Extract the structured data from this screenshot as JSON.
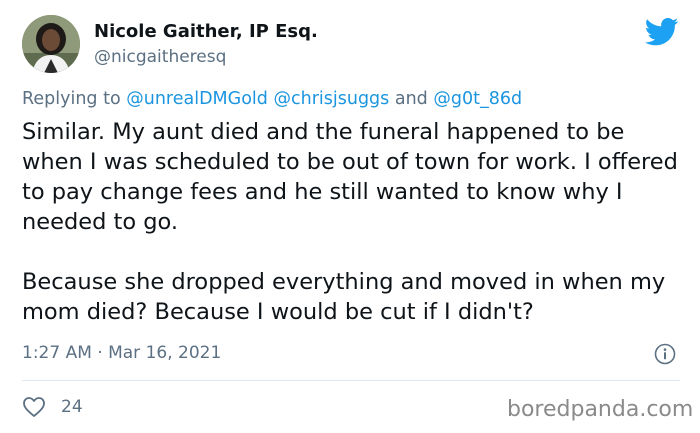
{
  "author": {
    "display_name": "Nicole Gaither, IP Esq.",
    "handle": "@nicgaitheresq"
  },
  "reply_context": {
    "prefix": "Replying to ",
    "mentions": [
      "@unrealDMGold",
      "@chrisjsuggs",
      "@g0t_86d"
    ],
    "connector": " and "
  },
  "tweet": {
    "text": "Similar. My aunt died and the funeral happened to be when I was scheduled to be out of town for work. I offered to pay change fees and he still wanted to know why I needed to go.\n\nBecause she dropped everything and moved in when my mom died? Because I would be cut if I didn't?",
    "timestamp": "1:27 AM · Mar 16, 2021"
  },
  "stats": {
    "likes": "24"
  },
  "watermark": "boredpanda.com",
  "icons": {
    "brand": "twitter-bird-icon",
    "info": "info-icon",
    "like": "heart-icon"
  },
  "colors": {
    "brand_blue": "#1da1f2",
    "mention_blue": "#1b95e0",
    "secondary_text": "#5b7083",
    "primary_text": "#0f1419"
  }
}
